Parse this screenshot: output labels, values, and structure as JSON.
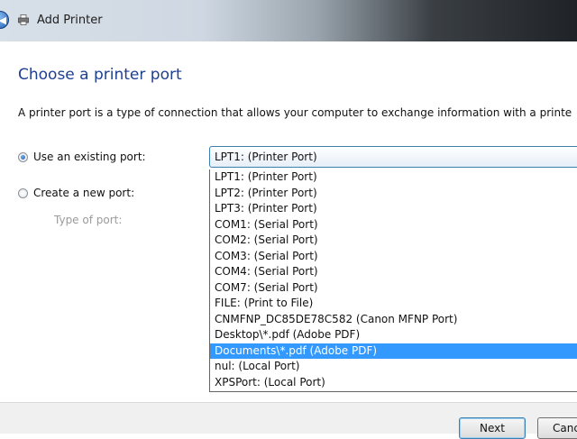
{
  "window": {
    "title": "Add Printer"
  },
  "page": {
    "heading": "Choose a printer port",
    "description": "A printer port is a type of connection that allows your computer to exchange information with a printe"
  },
  "options": {
    "existing_label": "Use an existing port:",
    "new_label": "Create a new port:",
    "type_label": "Type of port:",
    "selected_existing": true
  },
  "port_select": {
    "value": "LPT1: (Printer Port)",
    "items": [
      "LPT1: (Printer Port)",
      "LPT2: (Printer Port)",
      "LPT3: (Printer Port)",
      "COM1: (Serial Port)",
      "COM2: (Serial Port)",
      "COM3: (Serial Port)",
      "COM4: (Serial Port)",
      "COM7: (Serial Port)",
      "FILE: (Print to File)",
      "CNMFNP_DC85DE78C582 (Canon MFNP Port)",
      "Desktop\\*.pdf (Adobe PDF)",
      "Documents\\*.pdf (Adobe PDF)",
      "nul: (Local Port)",
      "XPSPort: (Local Port)"
    ],
    "highlighted_index": 11
  },
  "buttons": {
    "next": "Next",
    "cancel": "Cancel"
  },
  "colors": {
    "heading": "#1f3f8f",
    "highlight": "#3399ff"
  }
}
